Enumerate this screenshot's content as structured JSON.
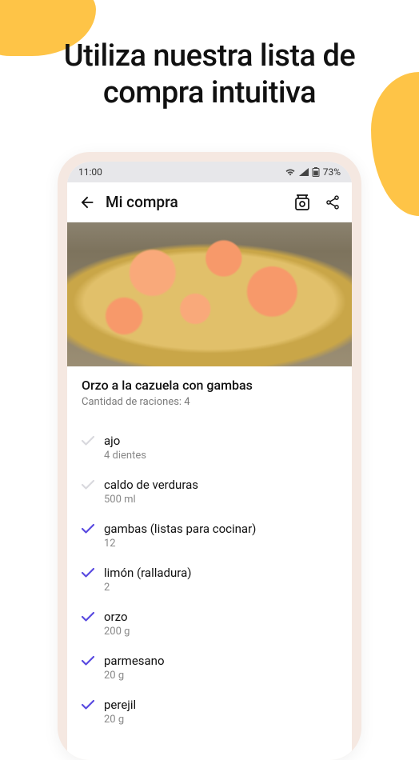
{
  "headline_line1": "Utiliza nuestra lista de",
  "headline_line2": "compra intuitiva",
  "status": {
    "time": "11:00",
    "battery": "73%"
  },
  "appbar": {
    "title": "Mi compra"
  },
  "recipe": {
    "title": "Orzo a la cazuela con gambas",
    "servings": "Cantidad de raciones: 4"
  },
  "ingredients": [
    {
      "name": "ajo",
      "qty": "4 dientes",
      "checked": false
    },
    {
      "name": "caldo de verduras",
      "qty": "500 ml",
      "checked": false
    },
    {
      "name": "gambas (listas para cocinar)",
      "qty": "12",
      "checked": true
    },
    {
      "name": "limón (ralladura)",
      "qty": "2",
      "checked": true
    },
    {
      "name": "orzo",
      "qty": "200 g",
      "checked": true
    },
    {
      "name": "parmesano",
      "qty": "20 g",
      "checked": true
    },
    {
      "name": "perejil",
      "qty": "20 g",
      "checked": true
    }
  ],
  "colors": {
    "accent": "#5a4be0",
    "muted_check": "#d9d9de"
  }
}
